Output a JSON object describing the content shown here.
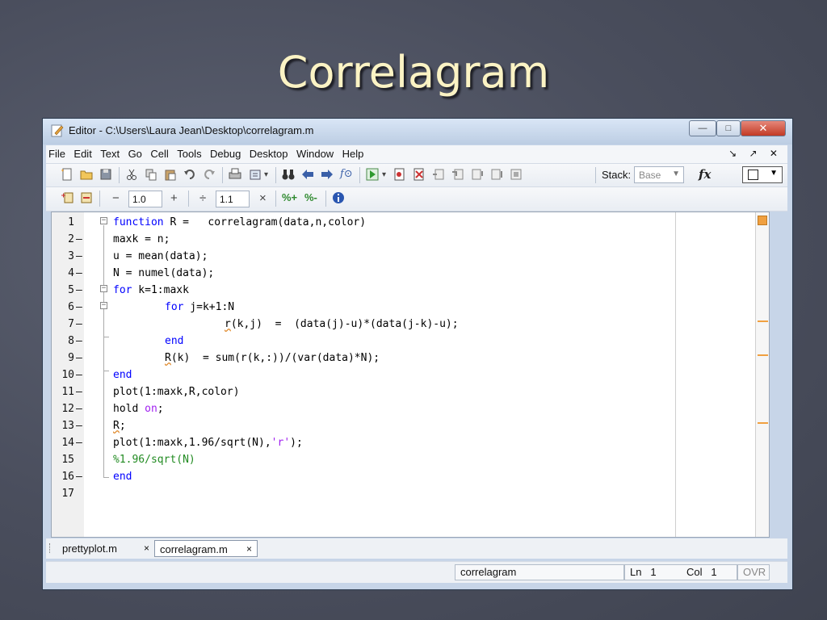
{
  "slide_title": "Correlagram",
  "window": {
    "title": "Editor - C:\\Users\\Laura Jean\\Desktop\\correlagram.m",
    "min_label": "—",
    "max_label": "□",
    "close_label": "✕"
  },
  "menu": [
    "File",
    "Edit",
    "Text",
    "Go",
    "Cell",
    "Tools",
    "Debug",
    "Desktop",
    "Window",
    "Help"
  ],
  "menu_right": "↘ ↗ ✕",
  "toolbar": {
    "stack_label": "Stack:",
    "stack_value": "Base",
    "fx_label": "fx"
  },
  "cell_toolbar": {
    "minus": "−",
    "value1": "1.0",
    "plus": "+",
    "divide": "÷",
    "value2": "1.1",
    "times": "×"
  },
  "code_lines": [
    {
      "n": "1",
      "dash": ""
    },
    {
      "n": "2",
      "dash": "–"
    },
    {
      "n": "3",
      "dash": "–"
    },
    {
      "n": "4",
      "dash": "–"
    },
    {
      "n": "5",
      "dash": "–"
    },
    {
      "n": "6",
      "dash": "–"
    },
    {
      "n": "7",
      "dash": "–"
    },
    {
      "n": "8",
      "dash": "–"
    },
    {
      "n": "9",
      "dash": "–"
    },
    {
      "n": "10",
      "dash": "–"
    },
    {
      "n": "11",
      "dash": "–"
    },
    {
      "n": "12",
      "dash": "–"
    },
    {
      "n": "13",
      "dash": "–"
    },
    {
      "n": "14",
      "dash": "–"
    },
    {
      "n": "15",
      "dash": ""
    },
    {
      "n": "16",
      "dash": "–"
    },
    {
      "n": "17",
      "dash": ""
    }
  ],
  "code": {
    "l1_kw": "function",
    "l1_rest": " R =   correlagram(data,n,color)",
    "l2": "maxk = n;",
    "l3": "u = mean(data);",
    "l4": "N = numel(data);",
    "l5_kw": "for",
    "l5_rest": " k=1:maxk",
    "l6_kw": "for",
    "l6_rest": " j=k+1:N",
    "l7_warn": "r",
    "l7_rest": "(k,j)  =  (data(j)-u)*(data(j-k)-u);",
    "l8_kw": "end",
    "l9_warn": "R",
    "l9_rest": "(k)  = sum(r(k,:))/(var(data)*N);",
    "l10_kw": "end",
    "l11": "plot(1:maxk,R,color)",
    "l12_a": "hold ",
    "l12_str": "on",
    "l12_b": ";",
    "l13_warn": "R",
    "l13_rest": ";",
    "l14_a": "plot(1:maxk,1.96/sqrt(N),",
    "l14_str": "'r'",
    "l14_b": ");",
    "l15_cmt": "%1.96/sqrt(N)",
    "l16_kw": "end"
  },
  "tabs": [
    {
      "label": "prettyplot.m",
      "close": "×"
    },
    {
      "label": "correlagram.m",
      "close": "×"
    }
  ],
  "status": {
    "function_name": "correlagram",
    "ln_label": "Ln",
    "ln_value": "1",
    "col_label": "Col",
    "col_value": "1",
    "ovr": "OVR"
  },
  "colors": {
    "keyword": "#0000ff",
    "string": "#a020f0",
    "comment": "#228b22",
    "warning_marker": "#f0a040",
    "slide_title": "#fbf3c4"
  }
}
